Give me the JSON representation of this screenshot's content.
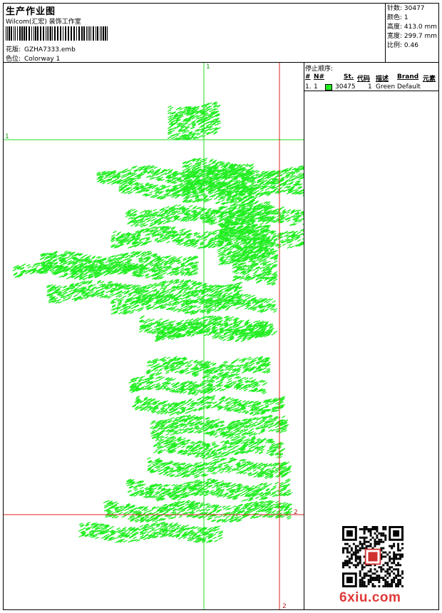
{
  "header": {
    "title": "生产作业图",
    "company": "Wilcom(汇宏) 装饰工作室",
    "design_label": "花版:",
    "design_value": "GZHA7333.emb",
    "colorway_label": "色位:",
    "colorway_value": "Colorway 1"
  },
  "stats": {
    "stitches": "针数: 30477",
    "colors": "颜色: 1",
    "height": "高度: 413.0 mm",
    "width": "宽度: 299.7 mm",
    "scale": "比例: 0.46"
  },
  "stop_sequence": {
    "title": "停止顺序:",
    "headers": [
      "#",
      "N#",
      "St.",
      "代码",
      "描述",
      "Brand",
      "元素"
    ],
    "rows": [
      {
        "idx": "1.",
        "needle": "1",
        "color": "#22ee22",
        "stitches": "30475",
        "code": "1",
        "description": "Green",
        "brand": "Default"
      }
    ]
  },
  "guides": {
    "top": "1",
    "left": "1",
    "right_marker": "2",
    "bottom_marker": "2"
  },
  "colors": {
    "thread": "#22ee22",
    "guide_green": "#22dd22",
    "guide_red": "#dd2222"
  },
  "watermark": "6xiu.com"
}
